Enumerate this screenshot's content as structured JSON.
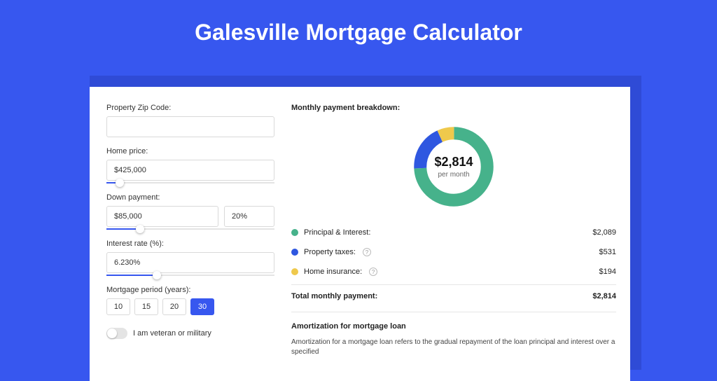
{
  "page": {
    "title": "Galesville Mortgage Calculator"
  },
  "form": {
    "zip_label": "Property Zip Code:",
    "zip_value": "",
    "home_price_label": "Home price:",
    "home_price_value": "$425,000",
    "home_price_slider_pct": 8,
    "down_payment_label": "Down payment:",
    "down_payment_value": "$85,000",
    "down_payment_pct": "20%",
    "down_payment_slider_pct": 20,
    "interest_label": "Interest rate (%):",
    "interest_value": "6.230%",
    "interest_slider_pct": 30,
    "period_label": "Mortgage period (years):",
    "period_options": [
      "10",
      "15",
      "20",
      "30"
    ],
    "period_selected": "30",
    "veteran_label": "I am veteran or military",
    "veteran_on": false
  },
  "breakdown": {
    "title": "Monthly payment breakdown:",
    "center_amount": "$2,814",
    "center_sub": "per month",
    "items": [
      {
        "label": "Principal & Interest:",
        "value": "$2,089",
        "color": "green",
        "help": false
      },
      {
        "label": "Property taxes:",
        "value": "$531",
        "color": "blue",
        "help": true
      },
      {
        "label": "Home insurance:",
        "value": "$194",
        "color": "yellow",
        "help": true
      }
    ],
    "total_label": "Total monthly payment:",
    "total_value": "$2,814"
  },
  "amortization": {
    "title": "Amortization for mortgage loan",
    "text": "Amortization for a mortgage loan refers to the gradual repayment of the loan principal and interest over a specified"
  },
  "chart_data": {
    "type": "pie",
    "title": "Monthly payment breakdown",
    "series": [
      {
        "name": "Principal & Interest",
        "value": 2089,
        "color": "#46b28b"
      },
      {
        "name": "Property taxes",
        "value": 531,
        "color": "#2f57e0"
      },
      {
        "name": "Home insurance",
        "value": 194,
        "color": "#efc94c"
      }
    ],
    "total": 2814,
    "unit": "USD per month",
    "donut": true
  }
}
